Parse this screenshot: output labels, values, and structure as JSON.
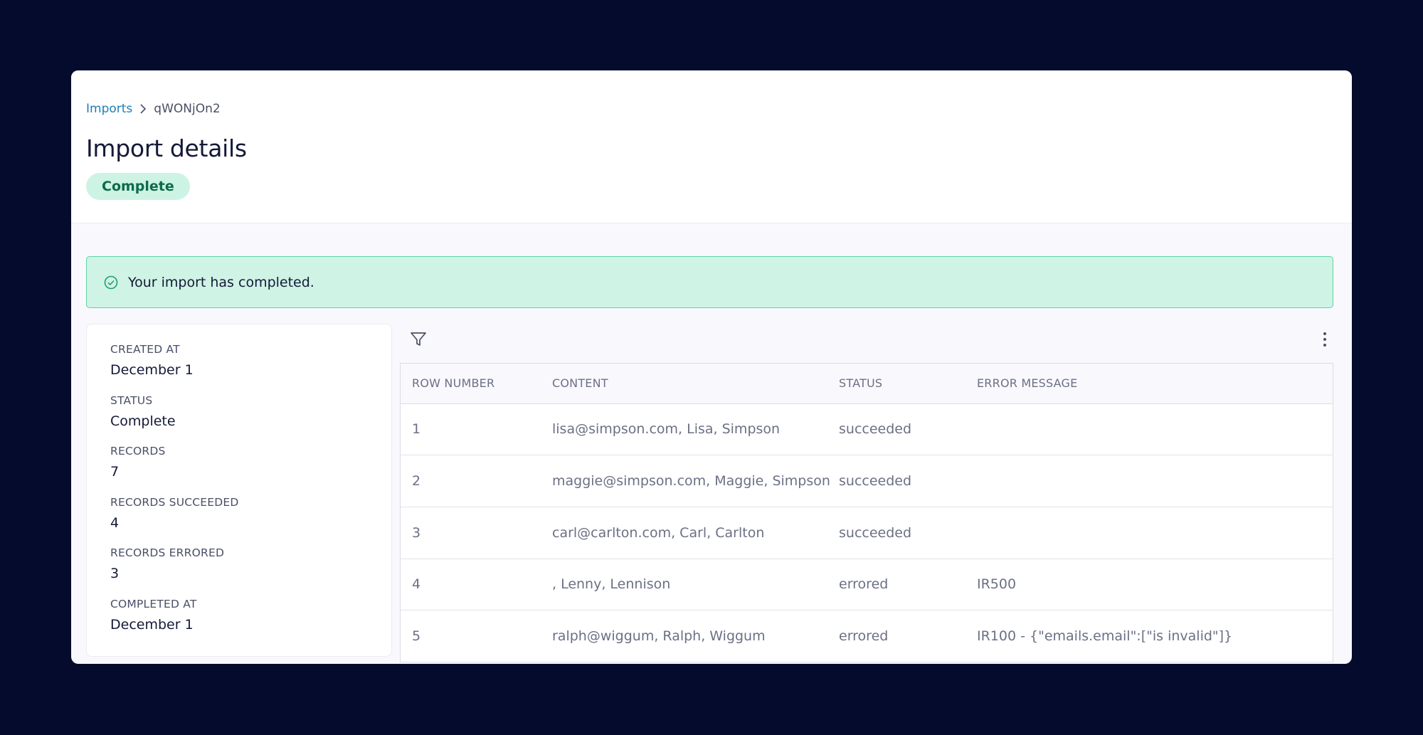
{
  "breadcrumb": {
    "root": "Imports",
    "current": "qWONjOn2"
  },
  "page": {
    "title": "Import details",
    "status": "Complete"
  },
  "alert": {
    "message": "Your import has completed."
  },
  "details": [
    {
      "label": "CREATED AT",
      "value": "December 1"
    },
    {
      "label": "STATUS",
      "value": "Complete"
    },
    {
      "label": "RECORDS",
      "value": "7"
    },
    {
      "label": "RECORDS SUCCEEDED",
      "value": "4"
    },
    {
      "label": "RECORDS ERRORED",
      "value": "3"
    },
    {
      "label": "COMPLETED AT",
      "value": "December 1"
    }
  ],
  "table": {
    "columns": [
      "ROW NUMBER",
      "CONTENT",
      "STATUS",
      "ERROR MESSAGE"
    ],
    "rows": [
      {
        "row": "1",
        "content": "lisa@simpson.com, Lisa, Simpson",
        "status": "succeeded",
        "error": ""
      },
      {
        "row": "2",
        "content": "maggie@simpson.com, Maggie, Simpson",
        "status": "succeeded",
        "error": ""
      },
      {
        "row": "3",
        "content": "carl@carlton.com, Carl, Carlton",
        "status": "succeeded",
        "error": ""
      },
      {
        "row": "4",
        "content": ", Lenny, Lennison",
        "status": "errored",
        "error": "IR500"
      },
      {
        "row": "5",
        "content": "ralph@wiggum, Ralph, Wiggum",
        "status": "errored",
        "error": "IR100 - {\"emails.email\":[\"is invalid\"]}"
      }
    ]
  },
  "colors": {
    "background": "#050b2c",
    "link": "#1e7fb8",
    "success_bg": "#cff3e4",
    "success_border": "#5fd3a6",
    "success_text": "#0d6b4d"
  },
  "icons": {
    "breadcrumb_separator": "chevron-right-icon",
    "alert": "check-circle-icon",
    "filter": "filter-icon",
    "more": "more-vertical-icon"
  }
}
